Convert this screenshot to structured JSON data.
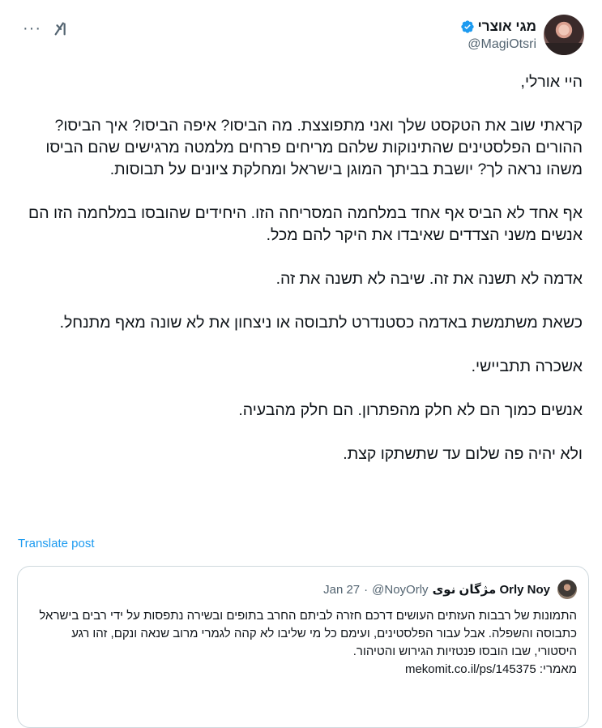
{
  "author": {
    "display_name": "מגי אוצרי",
    "handle": "@MagiOtsri",
    "avatar_icon": "avatar-photo",
    "verified": true
  },
  "actions": {
    "more_label": "···",
    "grok_icon": "grok-icon"
  },
  "tweet": {
    "paragraphs": [
      "היי אורלי,",
      "קראתי שוב את הטקסט שלך ואני מתפוצצת. מה הביסו? איפה הביסו? איך הביסו? ההורים הפלסטינים שהתינוקות שלהם מריחים פרחים מלמטה מרגישים שהם הביסו משהו נראה לך? יושבת בביתך המוגן בישראל ומחלקת ציונים על תבוסות.",
      "אף אחד לא הביס אף אחד במלחמה המסריחה הזו. היחידים שהובסו במלחמה הזו הם אנשים משני הצדדים שאיבדו את היקר להם מכל.",
      "אדמה לא תשנה את זה. שיבה לא תשנה את זה.",
      "כשאת משתמשת באדמה כסטנדרט לתבוסה או ניצחון את לא שונה מאף מתנחל.",
      "אשכרה תתביישי.",
      "אנשים כמוך הם לא חלק מהפתרון. הם חלק מהבעיה.",
      "ולא יהיה פה שלום עד שתשתקו קצת."
    ],
    "translate_label": "Translate post"
  },
  "quote": {
    "name": "Orly Noy مژگان نوی",
    "handle": "@NoyOrly",
    "date": "Jan 27",
    "separator": "·",
    "text": "התמונות של רבבות העזתים העושים דרכם חזרה לביתם החרב בתופים ובשירה נתפסות על ידי רבים בישראל כתבוסה והשפלה. אבל  עבור הפלסטינים, ועימם כל מי שליבו לא קהה לגמרי מרוב שנאה ונקם, זהו רגע  היסטורי, שבו הובסו פנטזיות הגירוש והטיהור.",
    "link_prefix": "מאמרי:",
    "link": "mekomit.co.il/ps/145375"
  }
}
